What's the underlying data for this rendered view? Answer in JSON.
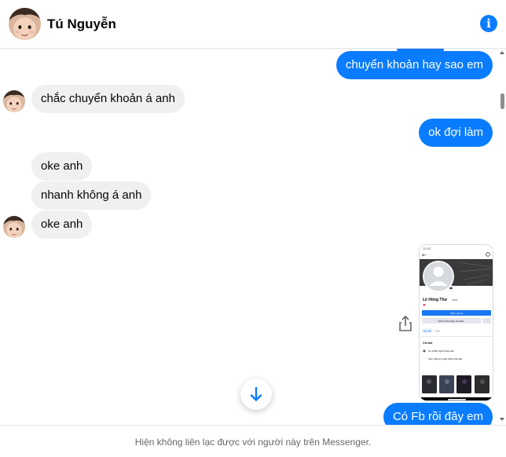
{
  "header": {
    "contact_name": "Tú Nguyễn",
    "info_icon": "info-icon"
  },
  "messages": [
    {
      "id": "m1",
      "direction": "outgoing",
      "text": "chuyển khoản hay sao em"
    },
    {
      "id": "m2",
      "direction": "incoming",
      "text": "chắc chuyển khoản á anh"
    },
    {
      "id": "m3",
      "direction": "outgoing",
      "text": "ok đợi làm"
    },
    {
      "id": "m4",
      "direction": "incoming",
      "text": "oke anh"
    },
    {
      "id": "m5",
      "direction": "incoming",
      "text": "nhanh không á anh"
    },
    {
      "id": "m6",
      "direction": "incoming",
      "text": "oke anh"
    },
    {
      "id": "m7",
      "direction": "outgoing",
      "type": "image",
      "text": ""
    },
    {
      "id": "m8",
      "direction": "outgoing",
      "text": "Có Fb rồi đây em"
    }
  ],
  "shared_image": {
    "profile_name": "Lê Hồng Thư",
    "profile_alt_name": "(Hthi)",
    "add_story_label": "Thêm vào tin",
    "edit_profile_label": "Chỉnh sửa trang cá nhân",
    "more_label": "···",
    "tabs": [
      "Bài viết",
      "Ảnh"
    ],
    "details_header": "Chi tiết",
    "followers_text": "Có 3.810 người theo dõi",
    "about_link_text": "Xem thông tin giới thiệu của bạn"
  },
  "icons": {
    "share": "share-icon",
    "scroll_down": "arrow-down-icon"
  },
  "footer": {
    "status_text": "Hiện không liên lạc được với người này trên Messenger."
  },
  "colors": {
    "outgoing_bubble": "#0a7cff",
    "incoming_bubble": "#f0f0f0",
    "accent": "#0a7cff"
  }
}
